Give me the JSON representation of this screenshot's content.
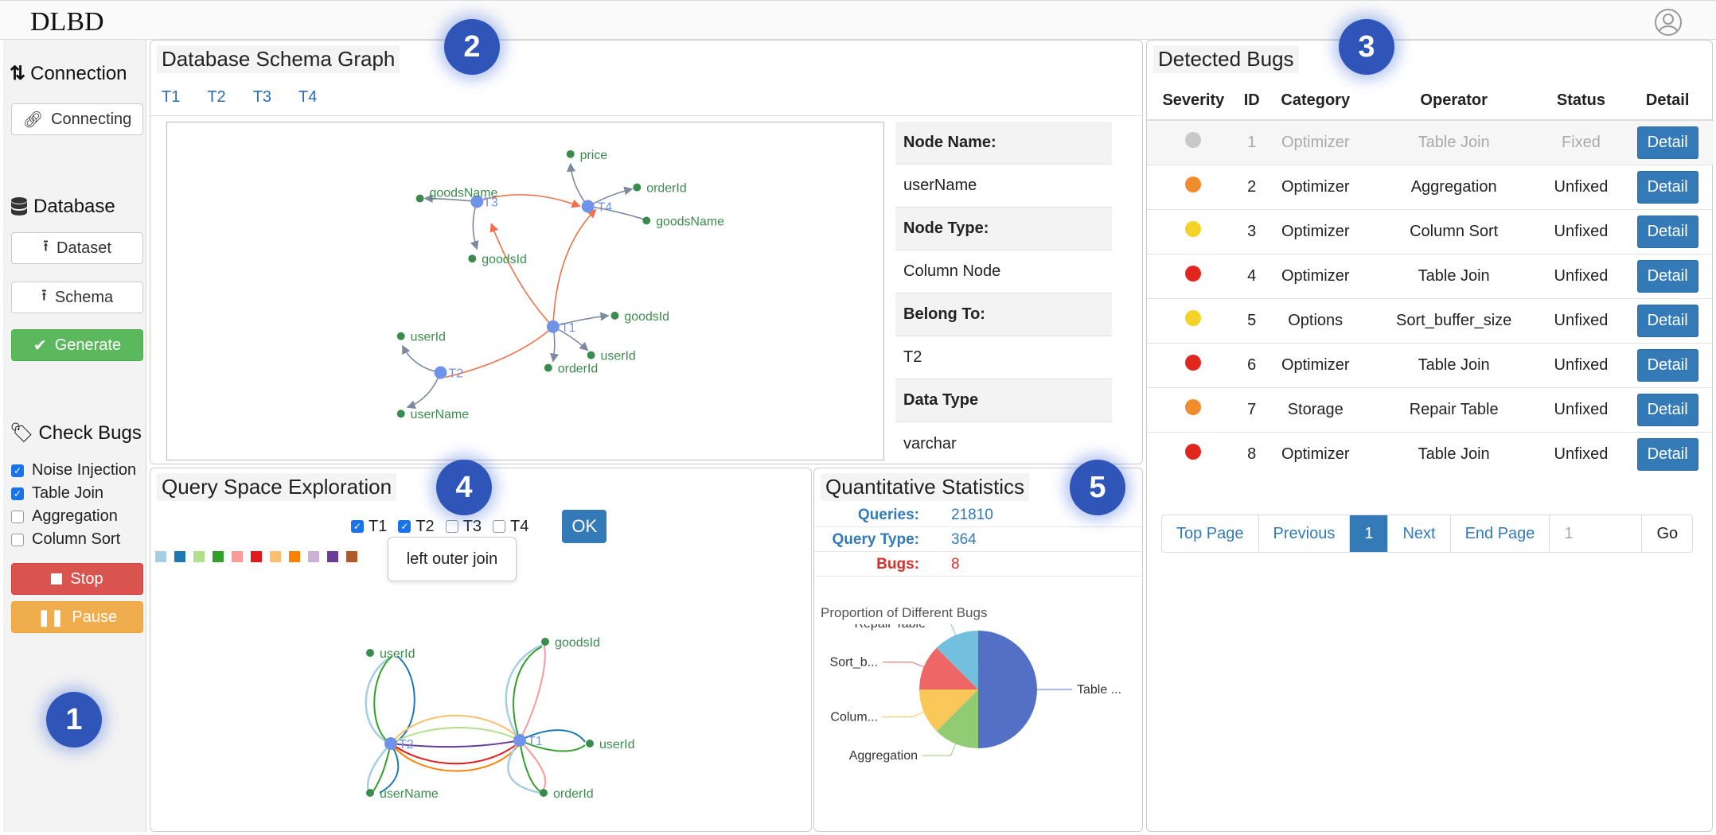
{
  "app": {
    "title": "DLBD"
  },
  "sidebar": {
    "connection_title": "Connection",
    "connecting_label": "Connecting",
    "database_title": "Database",
    "dataset_label": "Dataset",
    "schema_label": "Schema",
    "generate_label": "Generate",
    "check_bugs_title": "Check Bugs",
    "checks": [
      {
        "label": "Noise Injection",
        "checked": true
      },
      {
        "label": "Table Join",
        "checked": true
      },
      {
        "label": "Aggregation",
        "checked": false
      },
      {
        "label": "Column Sort",
        "checked": false
      }
    ],
    "stop_label": "Stop",
    "pause_label": "Pause"
  },
  "badges": [
    "1",
    "2",
    "3",
    "4",
    "5"
  ],
  "schema_graph": {
    "title": "Database Schema Graph",
    "tabs": [
      "T1",
      "T2",
      "T3",
      "T4"
    ],
    "node_labels": {
      "t1": "T1",
      "t2": "T2",
      "t3": "T3",
      "t4": "T4",
      "price": "price",
      "orderId_t4": "orderId",
      "goodsName_t4": "goodsName",
      "goodsName_t3": "goodsName",
      "goodsId_t3": "goodsId",
      "goodsId_t1": "goodsId",
      "userId_t1": "userId",
      "orderId_t1": "orderId",
      "userId_t2": "userId",
      "userName_t2": "userName"
    },
    "node_info": {
      "name_label": "Node Name:",
      "name_value": "userName",
      "type_label": "Node Type:",
      "type_value": "Column Node",
      "belong_label": "Belong To:",
      "belong_value": "T2",
      "datatype_label": "Data Type",
      "datatype_value": "varchar"
    },
    "colors": {
      "node": "#6f93e8",
      "column": "#3c8b4e",
      "edge_main": "#f0704a",
      "edge_col": "#7d8aa0"
    }
  },
  "bugs": {
    "title": "Detected Bugs",
    "headers": [
      "Severity",
      "ID",
      "Category",
      "Operator",
      "Status",
      "Detail"
    ],
    "detail_label": "Detail",
    "rows": [
      {
        "color": "#c8c8c8",
        "id": "1",
        "category": "Optimizer",
        "operator": "Table Join",
        "status": "Fixed"
      },
      {
        "color": "#f08c2e",
        "id": "2",
        "category": "Optimizer",
        "operator": "Aggregation",
        "status": "Unfixed"
      },
      {
        "color": "#f5d326",
        "id": "3",
        "category": "Optimizer",
        "operator": "Column Sort",
        "status": "Unfixed"
      },
      {
        "color": "#e0261f",
        "id": "4",
        "category": "Optimizer",
        "operator": "Table Join",
        "status": "Unfixed"
      },
      {
        "color": "#f5d326",
        "id": "5",
        "category": "Options",
        "operator": "Sort_buffer_size",
        "status": "Unfixed"
      },
      {
        "color": "#e0261f",
        "id": "6",
        "category": "Optimizer",
        "operator": "Table Join",
        "status": "Unfixed"
      },
      {
        "color": "#f08c2e",
        "id": "7",
        "category": "Storage",
        "operator": "Repair Table",
        "status": "Unfixed"
      },
      {
        "color": "#e0261f",
        "id": "8",
        "category": "Optimizer",
        "operator": "Table Join",
        "status": "Unfixed"
      }
    ],
    "pager": {
      "top": "Top Page",
      "prev": "Previous",
      "current": "1",
      "next": "Next",
      "end": "End Page",
      "input_placeholder": "1",
      "go": "Go"
    }
  },
  "query_space": {
    "title": "Query Space Exploration",
    "tables": [
      {
        "label": "T1",
        "checked": true
      },
      {
        "label": "T2",
        "checked": true
      },
      {
        "label": "T3",
        "checked": false
      },
      {
        "label": "T4",
        "checked": false
      }
    ],
    "ok_label": "OK",
    "swatch_colors": [
      "#a6cee3",
      "#1f78b4",
      "#b2df8a",
      "#33a02c",
      "#fb9a99",
      "#e31a1c",
      "#fdbf6f",
      "#ff7f00",
      "#cab2d6",
      "#6a3d9a",
      "#b15928"
    ],
    "tooltip": "left outer join",
    "node_labels": {
      "t2": "T2",
      "t1": "T1",
      "userId_l": "userId",
      "goodsId": "goodsId",
      "userId_r": "userId",
      "userName": "userName",
      "orderId": "orderId"
    }
  },
  "stats": {
    "title": "Quantitative Statistics",
    "queries_label": "Queries:",
    "queries_value": "21810",
    "qtype_label": "Query Type:",
    "qtype_value": "364",
    "bugs_label": "Bugs:",
    "bugs_value": "8",
    "pie_title": "Proportion of Different Bugs"
  },
  "chart_data": {
    "type": "pie",
    "title": "Proportion of Different Bugs",
    "categories": [
      "Table ...",
      "Aggregation",
      "Colum...",
      "Sort_b...",
      "Repair Table"
    ],
    "values": [
      4,
      1,
      1,
      1,
      1
    ],
    "colors": [
      "#5470c6",
      "#91cc75",
      "#fac858",
      "#ee6666",
      "#73c0de"
    ]
  }
}
